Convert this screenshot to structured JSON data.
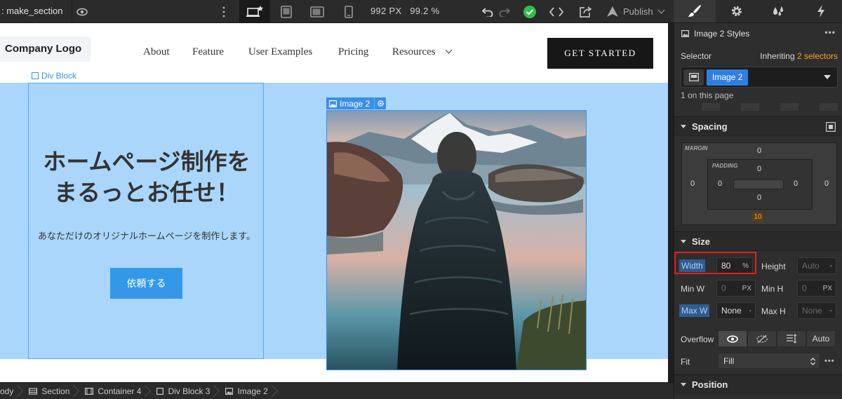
{
  "toolbar": {
    "page_name": ": make_section",
    "canvas_width": "992 PX",
    "zoom": "99.2 %",
    "publish_label": "Publish"
  },
  "site": {
    "logo": "Company Logo",
    "nav": [
      "About",
      "Feature",
      "User Examples",
      "Pricing",
      "Resources"
    ],
    "cta": "GET STARTED",
    "heading_line1": "ホームページ制作を",
    "heading_line2": "まるっとお任せ！",
    "subtitle": "あなただけのオリジナルホームページを制作します。",
    "button": "依頼する"
  },
  "canvas_labels": {
    "div_block": "Div Block",
    "image": "Image 2"
  },
  "breadcrumbs": [
    "ody",
    "Section",
    "Container 4",
    "Div Block 3",
    "Image 2"
  ],
  "panel": {
    "title": "Image 2 Styles",
    "selector_label": "Selector",
    "inheriting_prefix": "Inheriting ",
    "inheriting_count": "2 selectors",
    "selector_tag": "Image 2",
    "on_page": "1 on this page",
    "spacing": {
      "title": "Spacing",
      "margin_label": "MARGIN",
      "padding_label": "PADDING",
      "margin_top": "0",
      "margin_left": "0",
      "margin_right": "0",
      "margin_bottom": "10",
      "padding_top": "0",
      "padding_left": "0",
      "padding_right": "0",
      "padding_bottom": "0"
    },
    "size": {
      "title": "Size",
      "width_label": "Width",
      "width_value": "80",
      "width_unit": "%",
      "height_label": "Height",
      "height_value": "Auto",
      "height_unit": "-",
      "minw_label": "Min W",
      "minw_value": "0",
      "minw_unit": "PX",
      "minh_label": "Min H",
      "minh_value": "0",
      "minh_unit": "PX",
      "maxw_label": "Max W",
      "maxw_value": "None",
      "maxw_unit": "-",
      "maxh_label": "Max H",
      "maxh_value": "None",
      "maxh_unit": "-",
      "overflow_label": "Overflow",
      "overflow_auto": "Auto",
      "fit_label": "Fit",
      "fit_value": "Fill"
    },
    "position_title": "Position"
  },
  "colors": {
    "accent_blue": "#3b8ee8",
    "selector_orange": "#f5a623",
    "highlight_red": "#e0201f",
    "hero_bg": "#a9d6fa",
    "success_green": "#2fbf4a"
  }
}
